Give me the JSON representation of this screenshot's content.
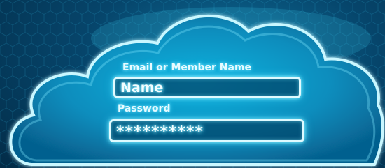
{
  "login_form": {
    "email_label": "Email or Member Name",
    "email_value": "Name",
    "password_label": "Password",
    "password_value": "**********"
  },
  "colors": {
    "background": "#04466d",
    "cloud_fill": "#0b97c6",
    "glow": "#8ff0ff"
  }
}
